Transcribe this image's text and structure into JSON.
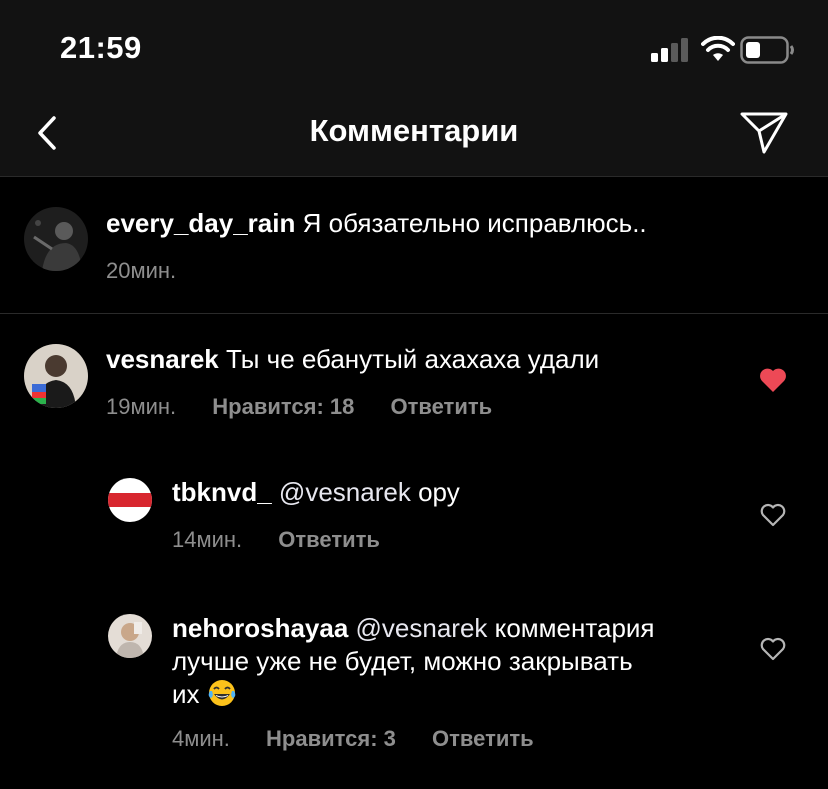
{
  "status_bar": {
    "time": "21:59",
    "icons": [
      "signal-icon",
      "wifi-icon",
      "battery-icon"
    ]
  },
  "header": {
    "title": "Комментарии",
    "back_icon": "chevron-left-icon",
    "send_icon": "paper-plane-icon"
  },
  "caption": {
    "username": "every_day_rain",
    "text": "Я обязательно исправлюсь..",
    "time": "20мин."
  },
  "comments": [
    {
      "username": "vesnarek",
      "text": "Ты че ебанутый ахахаха удали",
      "time": "19мин.",
      "likes": "Нравится: 18",
      "reply": "Ответить",
      "liked": true
    }
  ],
  "replies": [
    {
      "username": "tbknvd_",
      "mention": "@vesnarek",
      "text": "ору",
      "time": "14мин.",
      "reply": "Ответить",
      "liked": false
    },
    {
      "username": "nehoroshayaa",
      "mention": "@vesnarek",
      "text_line1": "комментария",
      "text_line2": "лучше уже не будет, можно закрывать",
      "text_line3": "их",
      "emoji": "laughing-tears-emoji",
      "time": "4мин.",
      "likes": "Нравится: 3",
      "reply": "Ответить",
      "liked": false
    }
  ],
  "colors": {
    "background": "#000000",
    "bar": "#121212",
    "meta": "#8e8e8e",
    "like_active": "#ed4956",
    "flag_red": "#d8272f"
  }
}
